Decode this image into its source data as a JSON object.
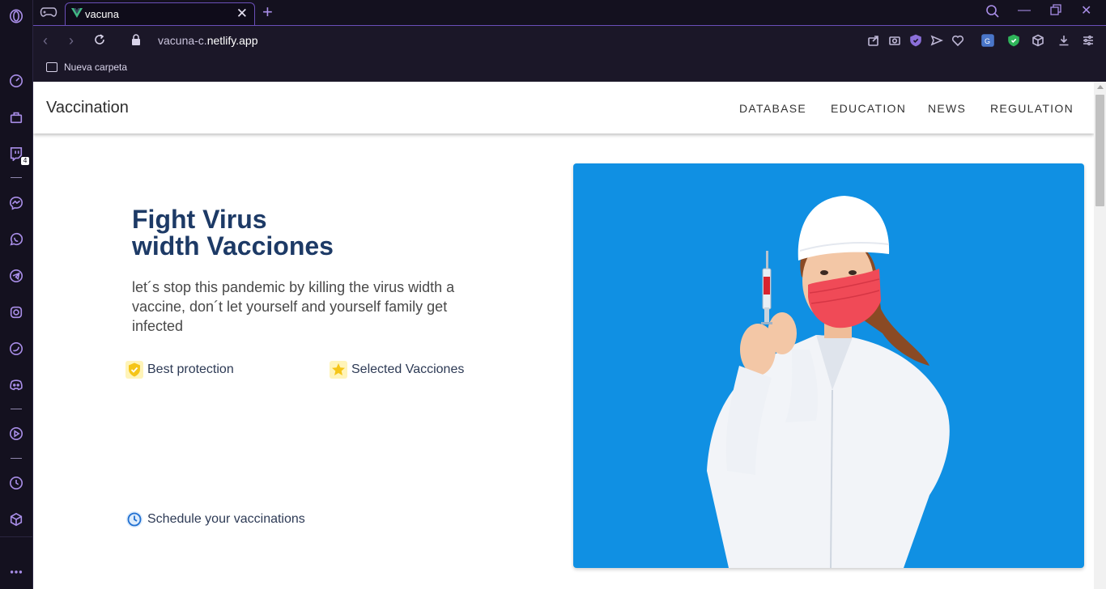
{
  "browser": {
    "tab_title": "vacuna",
    "url_prefix": "vacuna-c.",
    "url_domain": "netlify.app",
    "bookmark_folder": "Nueva carpeta",
    "twitch_badge": "4"
  },
  "site": {
    "brand": "Vaccination",
    "nav": [
      "DATABASE",
      "EDUCATION",
      "NEWS",
      "REGULATION"
    ],
    "hero_title_line1": "Fight Virus",
    "hero_title_line2": "width Vacciones",
    "hero_text": "let´s stop this pandemic by killing the virus width a vaccine, don´t let yourself and yourself family get infected",
    "feature_protection": "Best protection",
    "feature_selected": "Selected Vacciones",
    "feature_schedule": "Schedule your vaccinations"
  },
  "colors": {
    "accent": "#a98ee8",
    "hero_title": "#1d3a66",
    "photo_bg": "#1090e3",
    "badge_yellow": "#f5c518"
  }
}
